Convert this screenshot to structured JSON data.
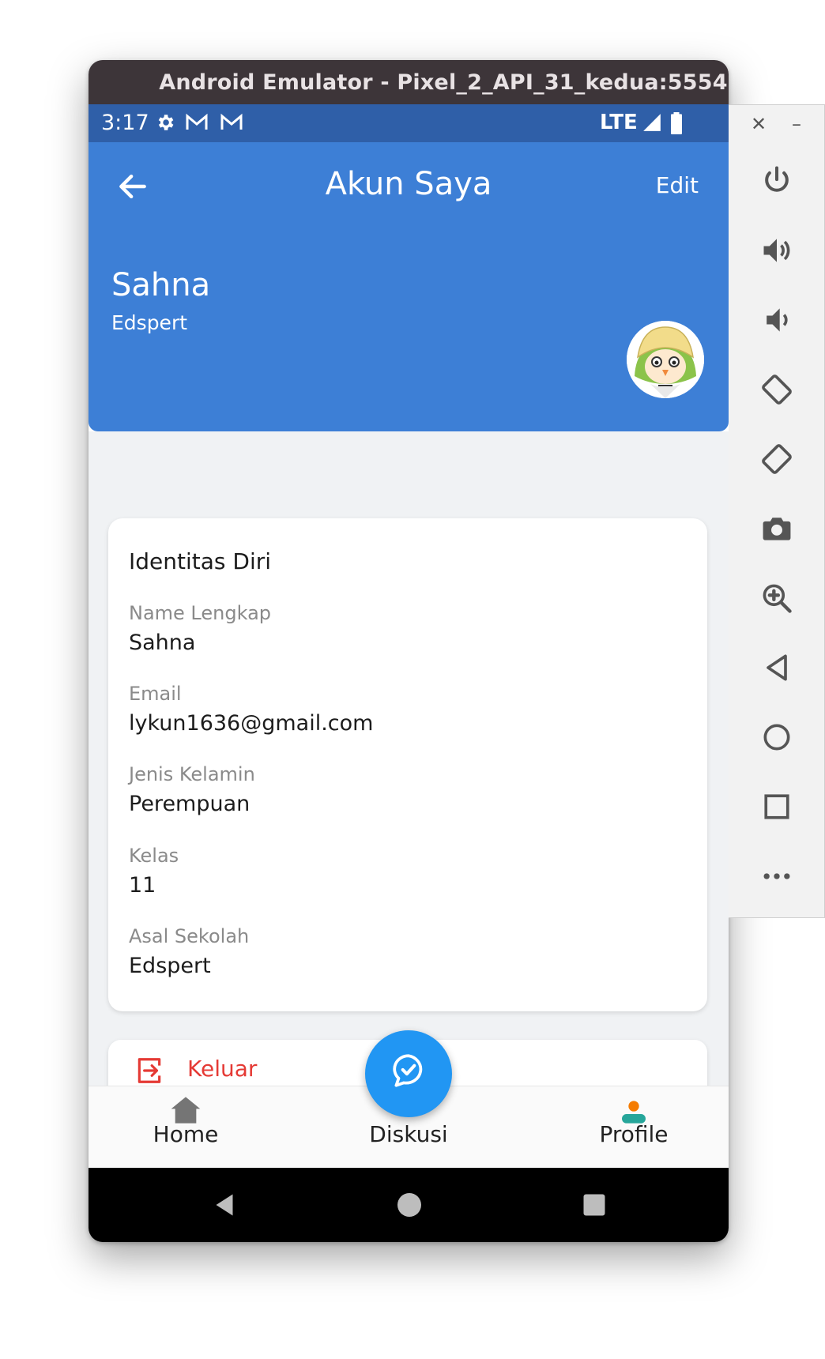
{
  "window": {
    "title": "Android Emulator - Pixel_2_API_31_kedua:5554"
  },
  "status_bar": {
    "time": "3:17",
    "network": "LTE",
    "icons": [
      "gear-icon",
      "gmail-icon",
      "gmail-icon",
      "signal-icon",
      "battery-icon"
    ]
  },
  "app_bar": {
    "title": "Akun Saya",
    "edit_label": "Edit"
  },
  "profile": {
    "name": "Sahna",
    "school": "Edspert"
  },
  "identity_card": {
    "title": "Identitas Diri",
    "fields": [
      {
        "label": "Name Lengkap",
        "value": "Sahna"
      },
      {
        "label": "Email",
        "value": "lykun1636@gmail.com"
      },
      {
        "label": "Jenis Kelamin",
        "value": "Perempuan"
      },
      {
        "label": "Kelas",
        "value": "11"
      },
      {
        "label": "Asal Sekolah",
        "value": "Edspert"
      }
    ]
  },
  "logout": {
    "label": "Keluar",
    "color": "#e53a35"
  },
  "bottom_nav": {
    "items": [
      {
        "label": "Home",
        "icon": "home-icon"
      },
      {
        "label": "Diskusi",
        "icon": "chat-check-icon"
      },
      {
        "label": "Profile",
        "icon": "person-icon"
      }
    ]
  },
  "colors": {
    "primary": "#3d7fd6",
    "status_bar": "#2f5fa8",
    "fab": "#2196f3",
    "background": "#f0f2f4"
  },
  "side_panel": {
    "buttons": [
      "close-icon",
      "minimize-icon",
      "power-icon",
      "volume-up-icon",
      "volume-down-icon",
      "rotate-left-icon",
      "rotate-right-icon",
      "camera-icon",
      "zoom-icon",
      "back-icon",
      "home-icon",
      "overview-icon",
      "more-icon"
    ]
  }
}
